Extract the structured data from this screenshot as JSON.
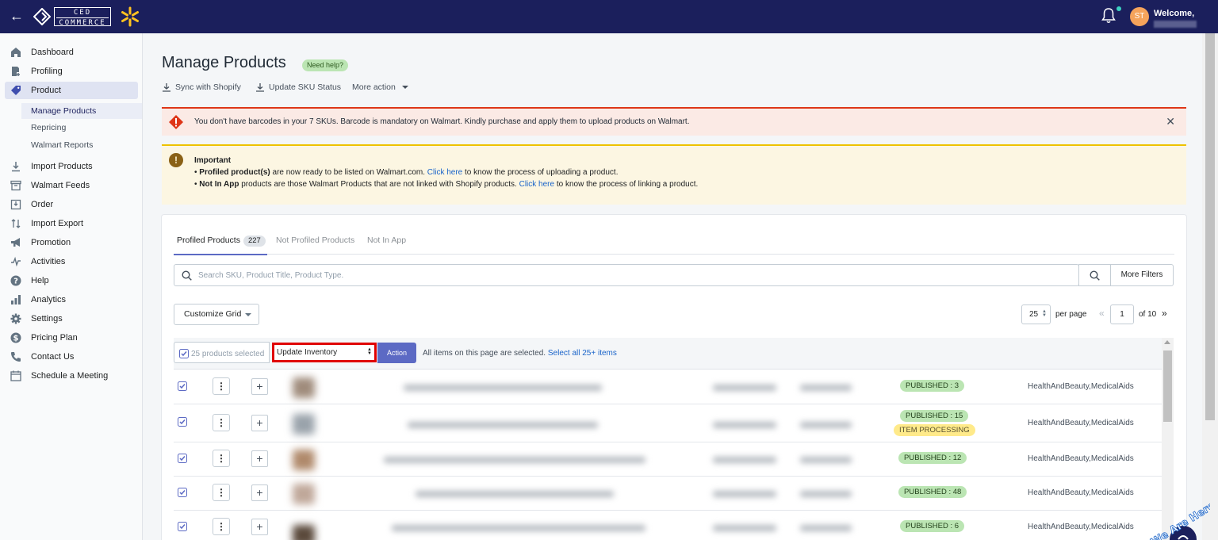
{
  "header": {
    "back_icon": "arrow-left-icon",
    "logo_line1": "CED",
    "logo_line2": "COMMERCE",
    "notification_icon": "bell-icon",
    "avatar_initials": "ST",
    "welcome": "Welcome,",
    "colors": {
      "bar": "#1b1f5c",
      "avatar": "#f5a35b",
      "walmart_spark": "#ffc220"
    }
  },
  "sidebar": {
    "items": [
      {
        "label": "Dashboard",
        "icon": "home-icon"
      },
      {
        "label": "Profiling",
        "icon": "profile-doc-icon"
      },
      {
        "label": "Product",
        "icon": "tag-icon",
        "active": true
      },
      {
        "label": "Import Products",
        "icon": "download-icon"
      },
      {
        "label": "Walmart Feeds",
        "icon": "archive-icon"
      },
      {
        "label": "Order",
        "icon": "inbox-icon"
      },
      {
        "label": "Import Export",
        "icon": "sort-arrows-icon"
      },
      {
        "label": "Promotion",
        "icon": "megaphone-icon"
      },
      {
        "label": "Activities",
        "icon": "activity-icon"
      },
      {
        "label": "Help",
        "icon": "question-icon"
      },
      {
        "label": "Analytics",
        "icon": "bar-chart-icon"
      },
      {
        "label": "Settings",
        "icon": "gear-icon"
      },
      {
        "label": "Pricing Plan",
        "icon": "dollar-icon"
      },
      {
        "label": "Contact Us",
        "icon": "phone-icon"
      },
      {
        "label": "Schedule a Meeting",
        "icon": "calendar-icon"
      }
    ],
    "product_sub": [
      "Manage Products",
      "Repricing",
      "Walmart Reports"
    ]
  },
  "page": {
    "title": "Manage Products",
    "help_badge": "Need help?",
    "actions": {
      "sync": "Sync with Shopify",
      "update_sku": "Update SKU Status",
      "more": "More action"
    }
  },
  "alert_error": {
    "text": "You don't have barcodes in your 7 SKUs. Barcode is mandatory on Walmart. Kindly purchase and apply them to upload products on Walmart."
  },
  "alert_important": {
    "title": "Important",
    "line1_bold": "Profiled product(s)",
    "line1_text": " are now ready to be listed on Walmart.com. ",
    "line1_link": "Click here",
    "line1_tail": " to know the process of uploading a product.",
    "line2_bold": "Not In App",
    "line2_text": " products are those Walmart Products that are not linked with Shopify products. ",
    "line2_link": "Click here",
    "line2_tail": " to know the process of linking a product."
  },
  "tabs": {
    "profiled": "Profiled Products",
    "profiled_count": "227",
    "not_profiled": "Not Profiled Products",
    "not_in_app": "Not In App"
  },
  "search": {
    "placeholder": "Search SKU, Product Title, Product Type.",
    "more_filters": "More Filters"
  },
  "grid": {
    "customize": "Customize Grid",
    "per_page_value": "25",
    "per_page_label": "per page",
    "page_value": "1",
    "page_of": "of 10"
  },
  "bulk": {
    "selected_label": "25 products selected",
    "action_select": "Update Inventory",
    "action_button": "Action",
    "message": "All items on this page are selected.",
    "select_all_link": "Select all 25+ items"
  },
  "rows": [
    {
      "status": [
        "PUBLISHED : 3"
      ],
      "category": "HealthAndBeauty,MedicalAids"
    },
    {
      "status": [
        "PUBLISHED : 15",
        "ITEM PROCESSING"
      ],
      "category": "HealthAndBeauty,MedicalAids"
    },
    {
      "status": [
        "PUBLISHED : 12"
      ],
      "category": "HealthAndBeauty,MedicalAids"
    },
    {
      "status": [
        "PUBLISHED : 48"
      ],
      "category": "HealthAndBeauty,MedicalAids"
    },
    {
      "status": [
        "PUBLISHED : 6"
      ],
      "category": "HealthAndBeauty,MedicalAids"
    }
  ],
  "widget": {
    "text": "We Are Here!"
  }
}
